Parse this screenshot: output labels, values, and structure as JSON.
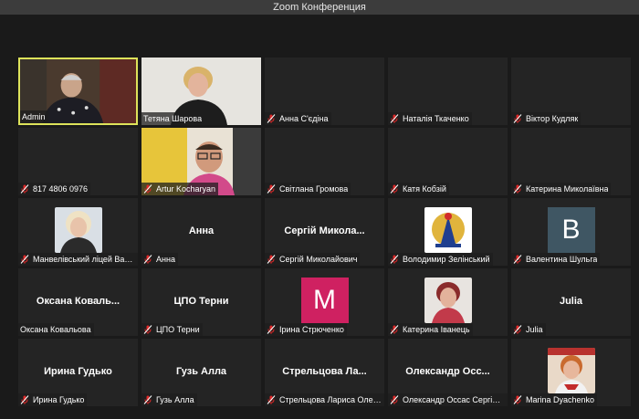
{
  "window": {
    "title": "Zoom Конференция"
  },
  "colors": {
    "active_border": "#dde35a",
    "muted_mic": "#e02828",
    "tile_bg": "#242424"
  },
  "participants": [
    {
      "label": "Admin",
      "muted": false,
      "video": "admin"
    },
    {
      "label": "Тетяна Шарова",
      "muted": false,
      "video": "woman-blonde"
    },
    {
      "label": "Анна С'єдіна",
      "muted": true
    },
    {
      "label": "Наталія Ткаченко",
      "muted": true
    },
    {
      "label": "Віктор Кудляк",
      "muted": true
    },
    {
      "label": "817 4806 0976",
      "muted": true
    },
    {
      "label": "Artur Kocharyan",
      "muted": true,
      "video": "man-glasses"
    },
    {
      "label": "Світлана Громова",
      "muted": true
    },
    {
      "label": "Катя Кобзій",
      "muted": true
    },
    {
      "label": "Катерина Миколаївна",
      "muted": true
    },
    {
      "label": "Манвелівський ліцей Васи...",
      "muted": true,
      "photo": "woman-portrait"
    },
    {
      "label": "Анна",
      "display_name": "Анна",
      "muted": true
    },
    {
      "label": "Сергій Миколайович",
      "display_name": "Сергій Микола...",
      "muted": true
    },
    {
      "label": "Володимир Зелінський",
      "muted": true,
      "photo": "logo-emblem"
    },
    {
      "label": "Валентина Шульга",
      "muted": true,
      "letter": "B",
      "letter_color": "#3f5663"
    },
    {
      "label": "Оксана Ковальова",
      "display_name": "Оксана Коваль...",
      "muted": false
    },
    {
      "label": "ЦПО Терни",
      "display_name": "ЦПО Терни",
      "muted": true
    },
    {
      "label": "Ірина Стрюченко",
      "muted": true,
      "letter": "M",
      "letter_color": "#cf2161"
    },
    {
      "label": "Катерина Іванець",
      "muted": true,
      "photo": "woman-red"
    },
    {
      "label": "Julia",
      "display_name": "Julia",
      "muted": true
    },
    {
      "label": "Ирина Гудько",
      "display_name": "Ирина Гудько",
      "muted": true
    },
    {
      "label": "Гузь Алла",
      "display_name": "Гузь Алла",
      "muted": true
    },
    {
      "label": "Стрельцова Лариса Олек...",
      "display_name": "Стрельцова Ла...",
      "muted": true
    },
    {
      "label": "Олександр Оссас Сергій К...",
      "display_name": "Олександр Осс...",
      "muted": true
    },
    {
      "label": "Marina Dyachenko",
      "muted": true,
      "photo": "woman-embroidery"
    }
  ]
}
